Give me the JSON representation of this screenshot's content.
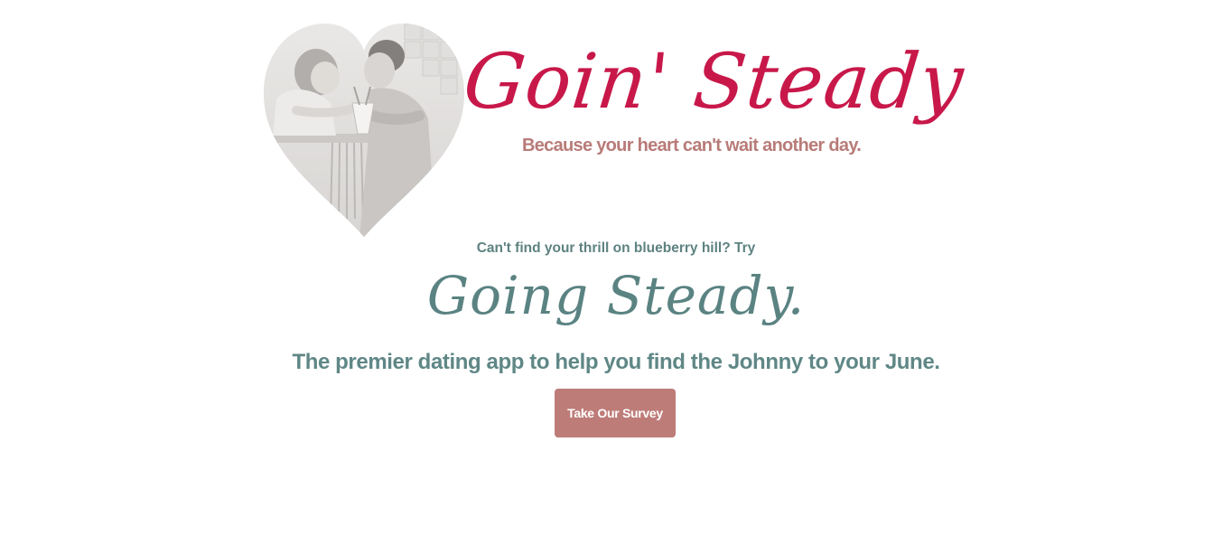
{
  "banner": {
    "logo_title": "Goin' Steady",
    "tagline": "Because your heart can't wait another day."
  },
  "hero": {
    "intro": "Can't find your thrill on blueberry hill? Try",
    "title": "Going Steady.",
    "subtitle": "The premier dating app to help you find the Johnny to your June.",
    "survey_button_label": "Take Our Survey"
  },
  "colors": {
    "brand_red": "#c8184a",
    "tagline_rose": "#b87b78",
    "teal_text": "#5a8382",
    "button_bg": "#be7c79"
  },
  "icons": {
    "heart_photo": "heart-shaped-vintage-couple-photo"
  }
}
